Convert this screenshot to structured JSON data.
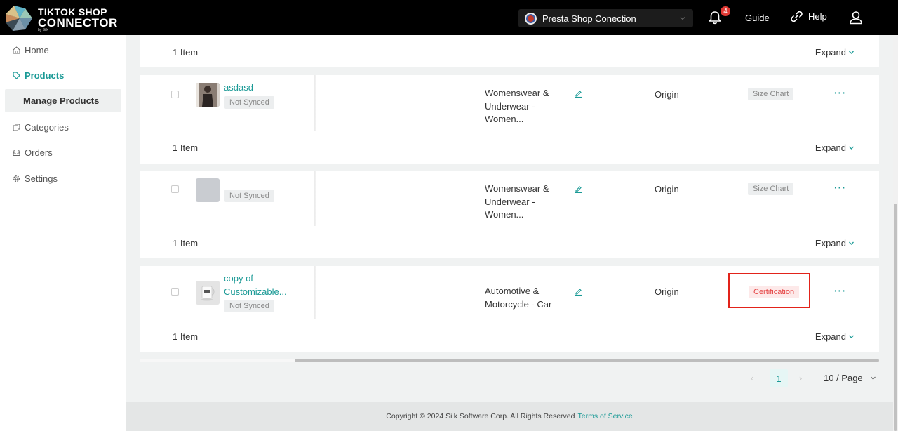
{
  "header": {
    "logo": {
      "line1": "TIKTOK SHOP",
      "line2": "CONNECTOR",
      "tagline": "by Silk"
    },
    "shop_selector": {
      "value": "Presta Shop Conection"
    },
    "notifications": {
      "count": "4"
    },
    "guide_label": "Guide",
    "help_label": "Help"
  },
  "sidebar": {
    "items": [
      {
        "label": "Home"
      },
      {
        "label": "Products"
      },
      {
        "label": "Manage Products"
      },
      {
        "label": "Categories"
      },
      {
        "label": "Orders"
      },
      {
        "label": "Settings"
      }
    ]
  },
  "table": {
    "item_bars": [
      {
        "count": "1 Item",
        "expand": "Expand"
      },
      {
        "count": "1 Item",
        "expand": "Expand"
      },
      {
        "count": "1 Item",
        "expand": "Expand"
      },
      {
        "count": "1 Item",
        "expand": "Expand"
      }
    ],
    "rows": [
      {
        "name": "asdasd",
        "status": "Not Synced",
        "category": "Womenswear & Underwear - Women...",
        "origin": "Origin",
        "attribute": "Size Chart",
        "more": "···"
      },
      {
        "name": "",
        "status": "Not Synced",
        "category": "Womenswear & Underwear - Women...",
        "origin": "Origin",
        "attribute": "Size Chart",
        "more": "···"
      },
      {
        "name": "copy of Customizable...",
        "status": "Not Synced",
        "category": "Automotive & Motorcycle - Car ...",
        "origin": "Origin",
        "attribute": "Certification",
        "more": "···"
      }
    ]
  },
  "pagination": {
    "prev": "‹",
    "current": "1",
    "next": "›",
    "page_size": "10 / Page"
  },
  "footer": {
    "copyright": "Copyright © 2024 Silk Software Corp. All Rights Reserved",
    "terms": "Terms of Service"
  },
  "colors": {
    "accent": "#1b9a96",
    "header_bg": "#000000",
    "alert": "#e23a35",
    "highlight_border": "#e2231a"
  }
}
